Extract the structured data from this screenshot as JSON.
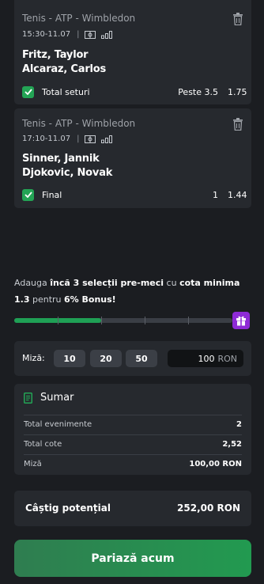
{
  "selections": [
    {
      "league": "Tenis - ATP - Wimbledon",
      "datetime": "15:30-11.07",
      "team1": "Fritz, Taylor",
      "team2": "Alcaraz, Carlos",
      "market": "Total seturi",
      "selection": "Peste 3.5",
      "odd": "1.75"
    },
    {
      "league": "Tenis - ATP - Wimbledon",
      "datetime": "17:10-11.07",
      "team1": "Sinner, Jannik",
      "team2": "Djokovic, Novak",
      "market": "Final",
      "selection": "1",
      "odd": "1.44"
    }
  ],
  "promo": {
    "p1": "Adauga ",
    "b1": "încă 3 selecții pre-meci",
    "p2": " cu ",
    "b2": "cota minima 1.3",
    "p3": " pentru ",
    "b3": "6% Bonus!",
    "progress_fraction": 0.4
  },
  "stake": {
    "label": "Miză:",
    "chips": [
      "10",
      "20",
      "50"
    ],
    "value": "100",
    "currency": "RON"
  },
  "summary": {
    "title": "Sumar",
    "rows": [
      {
        "label": "Total evenimente",
        "value": "2"
      },
      {
        "label": "Total cote",
        "value": "2,52"
      },
      {
        "label": "Miză",
        "value": "100,00 RON"
      }
    ]
  },
  "potential": {
    "label": "Câștig potențial",
    "value": "252,00 RON"
  },
  "bet_button": {
    "label": "Pariază acum"
  },
  "colors": {
    "background": "#1b1d21",
    "card": "#26292e",
    "accent_green": "#23a455",
    "gift_purple": "#8e2bd6"
  },
  "icons": {
    "delete": "trash-icon",
    "field": "stadium-icon",
    "stats": "stats-bars-icon",
    "check": "check-icon",
    "gift": "gift-icon",
    "summary": "document-icon"
  }
}
